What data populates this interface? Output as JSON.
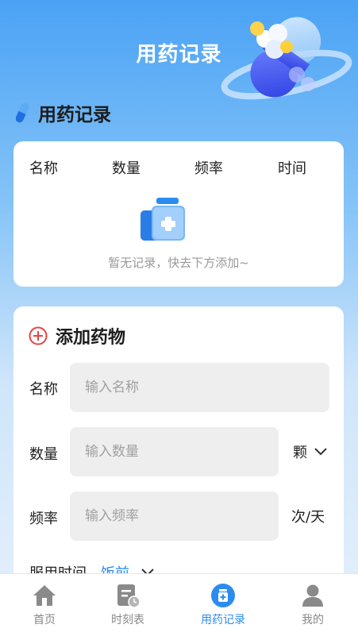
{
  "header": {
    "title": "用药记录"
  },
  "records": {
    "section_title": "用药记录",
    "columns": [
      "名称",
      "数量",
      "频率",
      "时间"
    ],
    "empty_text": "暂无记录，快去下方添加~"
  },
  "add_form": {
    "title": "添加药物",
    "name": {
      "label": "名称",
      "placeholder": "输入名称",
      "value": ""
    },
    "quantity": {
      "label": "数量",
      "placeholder": "输入数量",
      "value": "",
      "unit": "颗"
    },
    "frequency": {
      "label": "频率",
      "placeholder": "输入频率",
      "value": "",
      "unit": "次/天"
    },
    "time": {
      "label": "服用时间",
      "value": "饭前"
    }
  },
  "tabbar": {
    "items": [
      {
        "label": "首页",
        "icon": "home-icon",
        "active": false
      },
      {
        "label": "时刻表",
        "icon": "schedule-icon",
        "active": false
      },
      {
        "label": "用药记录",
        "icon": "medicine-record-icon",
        "active": true
      },
      {
        "label": "我的",
        "icon": "user-icon",
        "active": false
      }
    ]
  },
  "colors": {
    "accent": "#2b8cf0",
    "header_gradient_top": "#4aa2f5",
    "danger": "#e84343",
    "tab_inactive": "#888888"
  }
}
